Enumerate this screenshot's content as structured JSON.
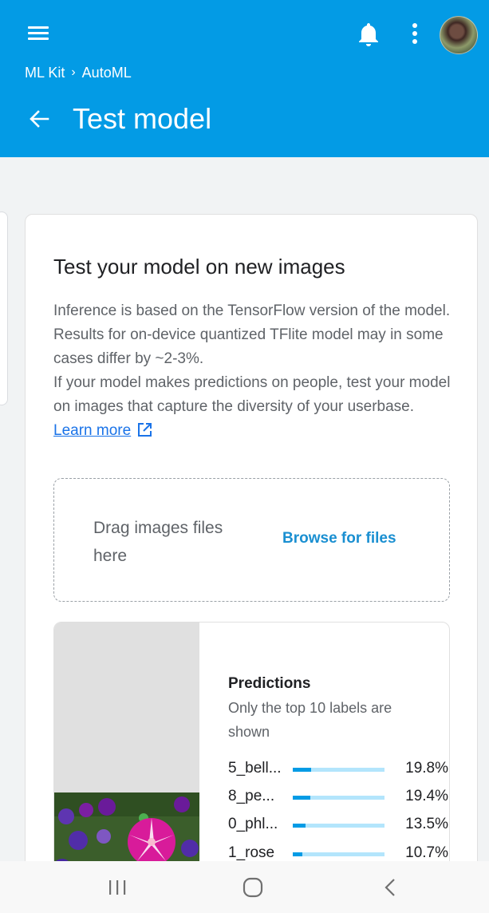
{
  "colors": {
    "primary": "#039be5",
    "link": "#1a73e8",
    "bar_track": "#b3e5fc",
    "bar_fill": "#039be5"
  },
  "header": {
    "menu_icon": "hamburger-menu-icon",
    "notification_icon": "bell-icon",
    "more_icon": "more-vert-icon",
    "breadcrumb": [
      "ML Kit",
      "AutoML"
    ],
    "breadcrumb_separator": "›",
    "back_icon": "arrow-back-icon",
    "title": "Test model"
  },
  "card": {
    "title": "Test your model on new images",
    "paragraph1": "Inference is based on the TensorFlow version of the model. Results for on-device quantized TFlite model may in some cases differ by ~2-3%.",
    "paragraph2": "If your model makes predictions on people, test your model on images that capture the diversity of your userbase.",
    "learn_more": "Learn more",
    "external_icon": "open-in-new-icon"
  },
  "dropzone": {
    "text": "Drag images files here",
    "browse_label": "Browse for files"
  },
  "predictions": {
    "title": "Predictions",
    "subtitle": "Only the top 10 labels are shown",
    "items": [
      {
        "label": "5_bell...",
        "percent": 19.8,
        "value_text": "19.8%"
      },
      {
        "label": "8_pe...",
        "percent": 19.4,
        "value_text": "19.4%"
      },
      {
        "label": "0_phl...",
        "percent": 13.5,
        "value_text": "13.5%"
      },
      {
        "label": "1_rose",
        "percent": 10.7,
        "value_text": "10.7%"
      }
    ]
  },
  "navbar": {
    "recents_icon": "recents-icon",
    "home_icon": "home-icon",
    "back_icon": "nav-back-icon"
  }
}
